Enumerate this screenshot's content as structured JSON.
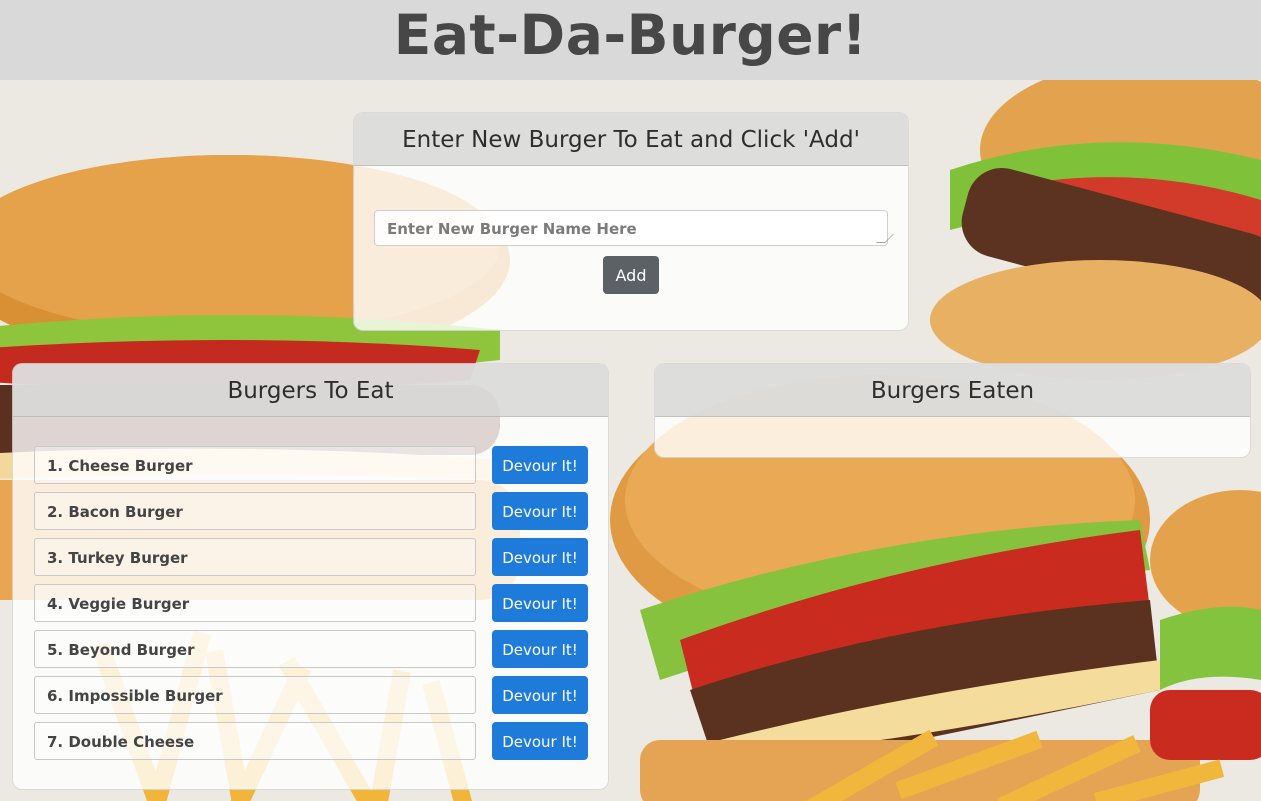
{
  "header": {
    "title": "Eat-Da-Burger!"
  },
  "add_form": {
    "heading": "Enter New Burger To Eat and Click 'Add'",
    "input_placeholder": "Enter New Burger Name Here",
    "add_label": "Add"
  },
  "to_eat": {
    "heading": "Burgers To Eat",
    "items": [
      {
        "name": "1. Cheese Burger",
        "button": "Devour It!"
      },
      {
        "name": "2. Bacon Burger",
        "button": "Devour It!"
      },
      {
        "name": "3. Turkey Burger",
        "button": "Devour It!"
      },
      {
        "name": "4. Veggie Burger",
        "button": "Devour It!"
      },
      {
        "name": "5. Beyond Burger",
        "button": "Devour It!"
      },
      {
        "name": "6. Impossible Burger",
        "button": "Devour It!"
      },
      {
        "name": "7. Double Cheese",
        "button": "Devour It!"
      }
    ]
  },
  "eaten": {
    "heading": "Burgers Eaten",
    "items": []
  },
  "colors": {
    "devour_button": "#1f7bd9",
    "add_button": "#5c6166",
    "header_bg": "#d9d9d9"
  }
}
